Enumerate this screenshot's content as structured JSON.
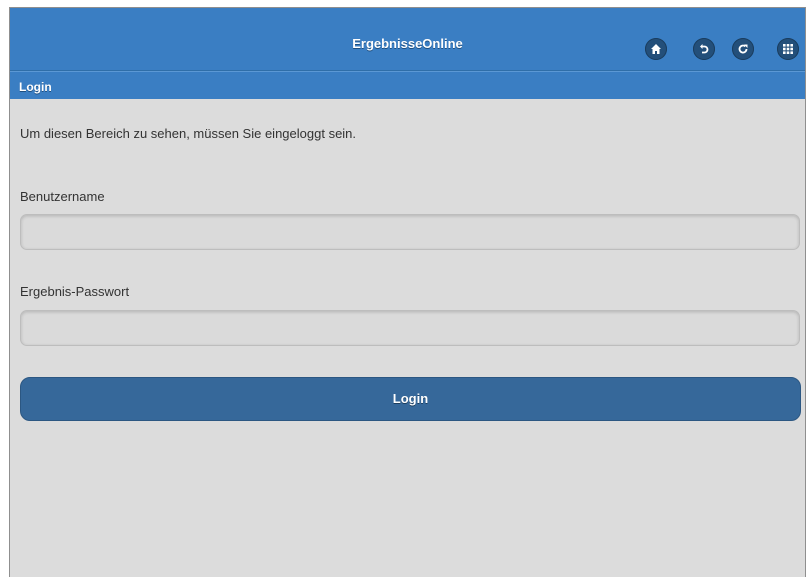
{
  "header": {
    "title": "ErgebnisseOnline",
    "icons": [
      "home-icon",
      "back-icon",
      "refresh-icon",
      "grid-icon"
    ]
  },
  "subheader": {
    "title": "Login"
  },
  "main": {
    "intro": "Um diesen Bereich zu sehen, müssen Sie eingeloggt sein.",
    "username_label": "Benutzername",
    "username_value": "",
    "password_label": "Ergebnis-Passwort",
    "password_value": "",
    "login_label": "Login"
  },
  "colors": {
    "header": "#3a7ec3",
    "icon_button": "#234f7a",
    "login_button": "#36689a",
    "background": "#dcdcdc"
  }
}
